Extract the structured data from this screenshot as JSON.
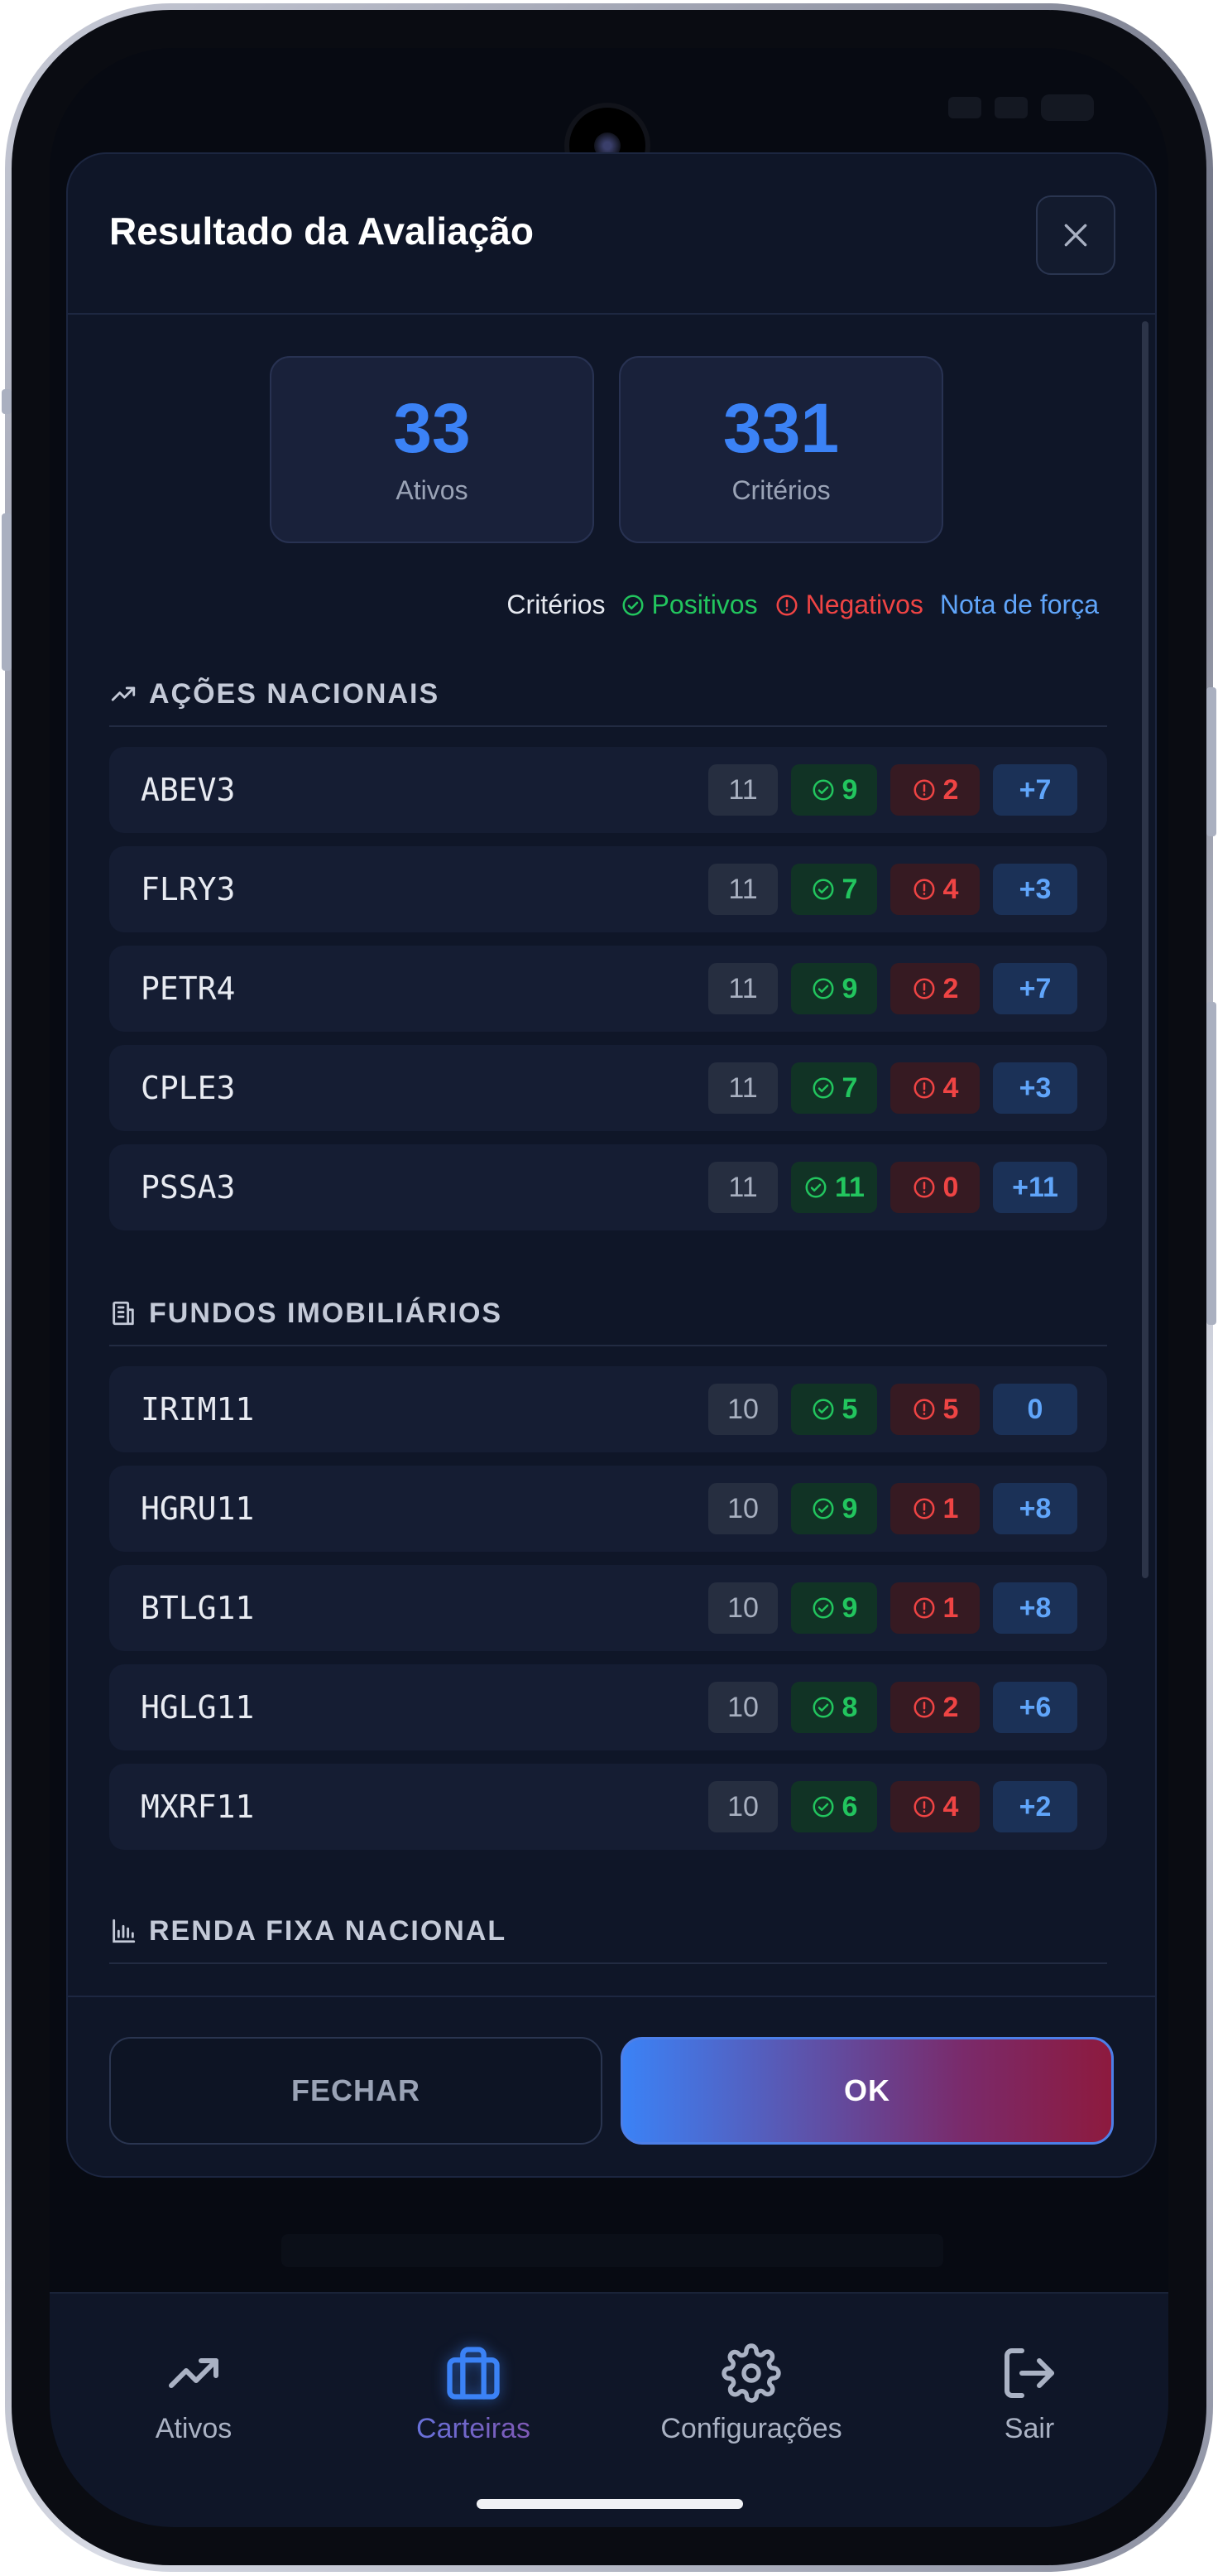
{
  "modal": {
    "title": "Resultado da Avaliação"
  },
  "stats": [
    {
      "value": "33",
      "label": "Ativos"
    },
    {
      "value": "331",
      "label": "Critérios"
    }
  ],
  "legend": {
    "criteria": "Critérios",
    "positive": "Positivos",
    "negative": "Negativos",
    "strength": "Nota de força"
  },
  "sections": [
    {
      "title": "AÇÕES NACIONAIS",
      "icon": "trending-up-icon",
      "rows": [
        {
          "ticker": "ABEV3",
          "total": "11",
          "pos": "9",
          "neg": "2",
          "score": "+7"
        },
        {
          "ticker": "FLRY3",
          "total": "11",
          "pos": "7",
          "neg": "4",
          "score": "+3"
        },
        {
          "ticker": "PETR4",
          "total": "11",
          "pos": "9",
          "neg": "2",
          "score": "+7"
        },
        {
          "ticker": "CPLE3",
          "total": "11",
          "pos": "7",
          "neg": "4",
          "score": "+3"
        },
        {
          "ticker": "PSSA3",
          "total": "11",
          "pos": "11",
          "neg": "0",
          "score": "+11"
        }
      ]
    },
    {
      "title": "FUNDOS IMOBILIÁRIOS",
      "icon": "building-icon",
      "rows": [
        {
          "ticker": "IRIM11",
          "total": "10",
          "pos": "5",
          "neg": "5",
          "score": "0"
        },
        {
          "ticker": "HGRU11",
          "total": "10",
          "pos": "9",
          "neg": "1",
          "score": "+8"
        },
        {
          "ticker": "BTLG11",
          "total": "10",
          "pos": "9",
          "neg": "1",
          "score": "+8"
        },
        {
          "ticker": "HGLG11",
          "total": "10",
          "pos": "8",
          "neg": "2",
          "score": "+6"
        },
        {
          "ticker": "MXRF11",
          "total": "10",
          "pos": "6",
          "neg": "4",
          "score": "+2"
        }
      ]
    },
    {
      "title": "RENDA FIXA NACIONAL",
      "icon": "bar-chart-icon",
      "rows": []
    }
  ],
  "footer": {
    "close_label": "FECHAR",
    "ok_label": "OK"
  },
  "nav": {
    "items": [
      {
        "label": "Ativos",
        "icon": "trending-up-icon"
      },
      {
        "label": "Carteiras",
        "icon": "briefcase-icon"
      },
      {
        "label": "Configurações",
        "icon": "gear-icon"
      },
      {
        "label": "Sair",
        "icon": "logout-icon"
      }
    ]
  },
  "colors": {
    "accent": "#3b82f6",
    "positive": "#22c55e",
    "negative": "#ef4444",
    "strength": "#60a5fa"
  }
}
